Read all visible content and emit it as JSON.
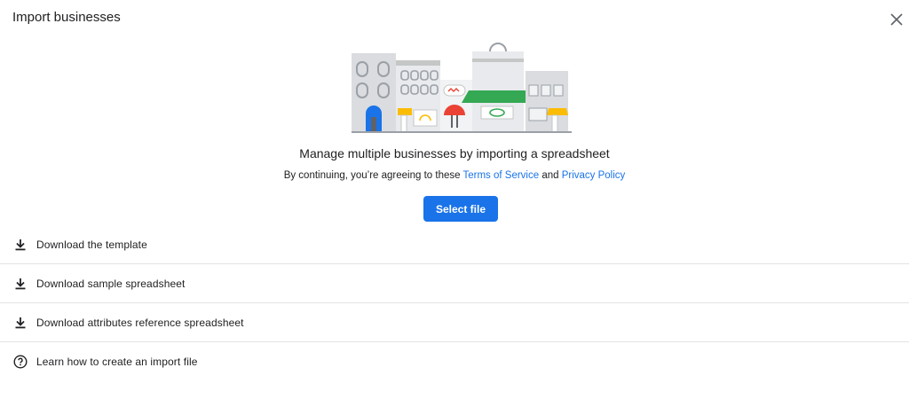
{
  "dialog": {
    "title": "Import businesses",
    "close_icon": "close-icon"
  },
  "main": {
    "headline": "Manage multiple businesses by importing a spreadsheet",
    "consent_prefix": "By continuing, you’re agreeing to these ",
    "terms_link": "Terms of Service",
    "consent_and": " and ",
    "privacy_link": "Privacy Policy",
    "select_file_label": "Select file",
    "accent_color": "#1a73e8"
  },
  "actions": [
    {
      "icon": "download-icon",
      "label": "Download the template"
    },
    {
      "icon": "download-icon",
      "label": "Download sample spreadsheet"
    },
    {
      "icon": "download-icon",
      "label": "Download attributes reference spreadsheet"
    },
    {
      "icon": "help-circle-icon",
      "label": "Learn how to create an import file"
    }
  ]
}
